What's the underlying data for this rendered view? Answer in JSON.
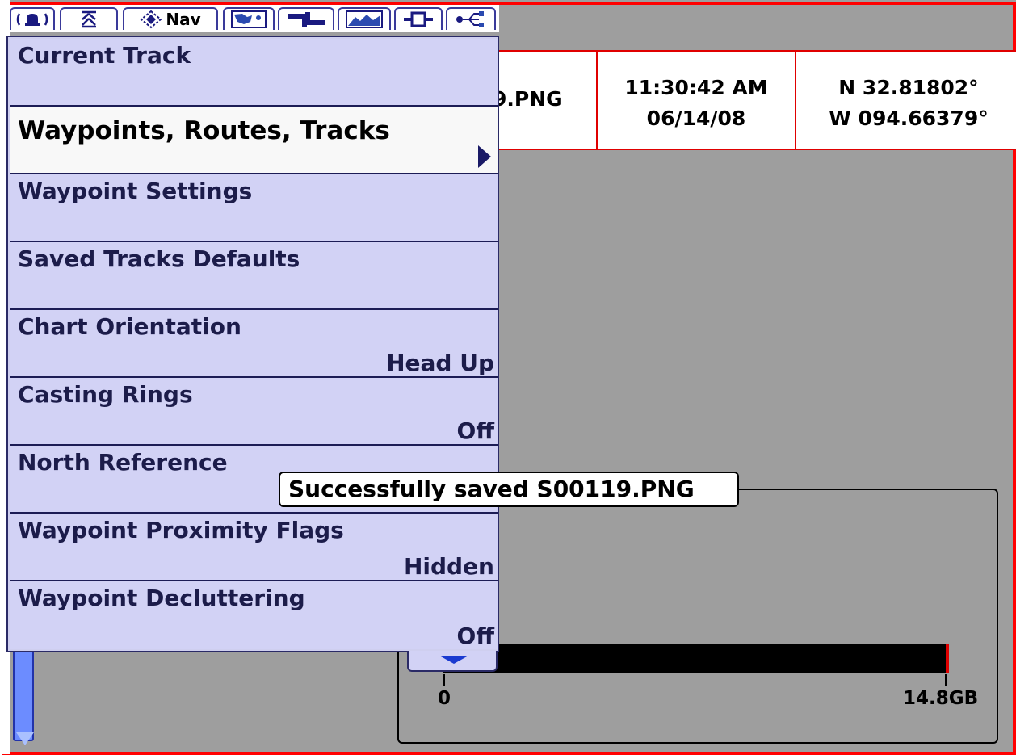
{
  "header": {
    "file_fragment": "9.PNG",
    "time": "11:30:42 AM",
    "date": "06/14/08",
    "latitude": "N 32.81802°",
    "longitude": "W 094.66379°"
  },
  "tabs": [
    {
      "id": "alarms",
      "icon": "alarm-bell-icon"
    },
    {
      "id": "sonar",
      "icon": "sonar-icon"
    },
    {
      "id": "nav",
      "icon": "nav-icon",
      "label": "Nav",
      "active": true
    },
    {
      "id": "chart",
      "icon": "chart-map-icon"
    },
    {
      "id": "setup",
      "icon": "setup-tools-icon"
    },
    {
      "id": "views",
      "icon": "views-icon"
    },
    {
      "id": "accessories",
      "icon": "accessory-icon"
    },
    {
      "id": "network",
      "icon": "network-icon"
    }
  ],
  "menu": {
    "items": [
      {
        "label": "Current Track",
        "value": ""
      },
      {
        "label": "Waypoints, Routes, Tracks",
        "value": "",
        "selected": true,
        "has_submenu": true
      },
      {
        "label": "Waypoint Settings",
        "value": ""
      },
      {
        "label": "Saved Tracks Defaults",
        "value": ""
      },
      {
        "label": "Chart Orientation",
        "value": "Head Up"
      },
      {
        "label": "Casting Rings",
        "value": "Off"
      },
      {
        "label": "North Reference",
        "value": ""
      },
      {
        "label": "Waypoint Proximity Flags",
        "value": "Hidden"
      },
      {
        "label": "Waypoint Decluttering",
        "value": "Off"
      }
    ]
  },
  "toast": {
    "message": "Successfully saved S00119.PNG"
  },
  "storage": {
    "min_label": "0",
    "max_label": "14.8GB",
    "used_fraction": 0.99
  },
  "colors": {
    "frame": "#ff0000",
    "menu_bg": "#d2d2f5",
    "menu_text": "#1c1c4a",
    "accent_blue": "#1a3ad0"
  }
}
